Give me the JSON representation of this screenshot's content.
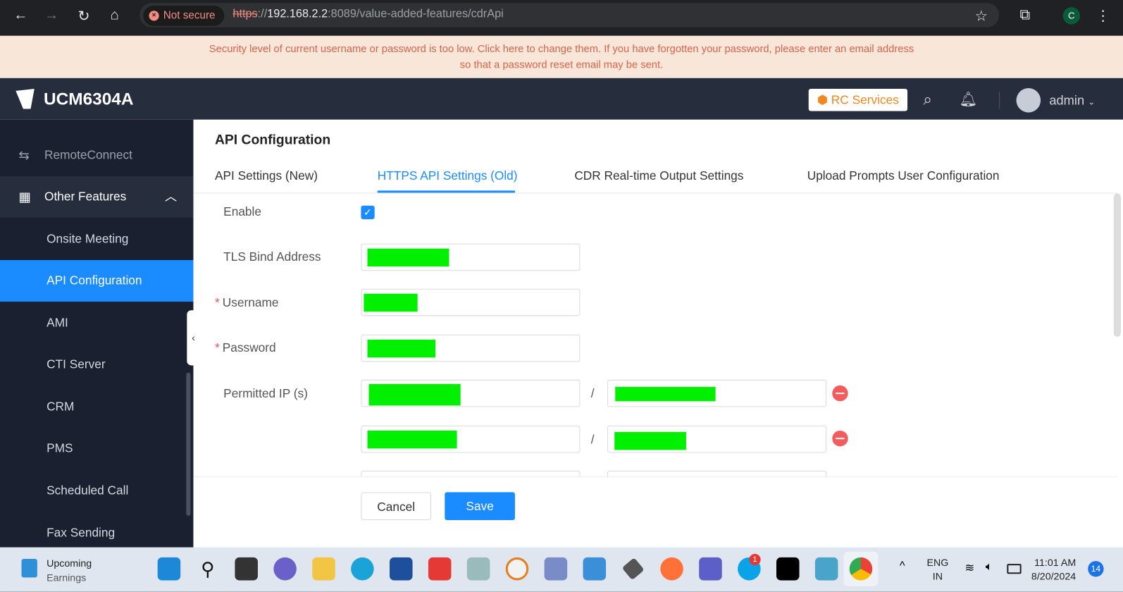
{
  "browser": {
    "security_label": "Not secure",
    "url_scheme": "https",
    "url_sep": "://",
    "url_host": "192.168.2.2",
    "url_rest": ":8089/value-added-features/cdrApi",
    "profile_initial": "C"
  },
  "banner": {
    "text": "Security level of current username or password is too low. Click here to change them. If you have forgotten your password, please enter an email address so that a password reset email may be sent."
  },
  "header": {
    "brand": "UCM6304A",
    "rc_services": "RC Services",
    "user": "admin"
  },
  "sidebar": {
    "items": [
      {
        "label": "RemoteConnect"
      },
      {
        "label": "Other Features"
      },
      {
        "label": "Onsite Meeting"
      },
      {
        "label": "API Configuration",
        "active": true
      },
      {
        "label": "AMI"
      },
      {
        "label": "CTI Server"
      },
      {
        "label": "CRM"
      },
      {
        "label": "PMS"
      },
      {
        "label": "Scheduled Call"
      },
      {
        "label": "Fax Sending"
      }
    ]
  },
  "main": {
    "title": "API Configuration",
    "tabs": [
      {
        "label": "API Settings (New)"
      },
      {
        "label": "HTTPS API Settings (Old)",
        "active": true
      },
      {
        "label": "CDR Real-time Output Settings"
      },
      {
        "label": "Upload Prompts User Configuration"
      }
    ],
    "form": {
      "enable_label": "Enable",
      "enable_checked": true,
      "tls_label": "TLS Bind Address",
      "username_label": "Username",
      "password_label": "Password",
      "permitted_label": "Permitted IP (s)",
      "slash": "/",
      "required_mark": "*"
    },
    "cancel": "Cancel",
    "save": "Save"
  },
  "colors": {
    "accent": "#1a8cff",
    "redaction": "#00f000",
    "sidebar": "#1b2030",
    "topbar": "#262d3d"
  },
  "taskbar": {
    "widget_title": "Upcoming",
    "widget_sub": "Earnings",
    "lang1": "ENG",
    "lang2": "IN",
    "time": "11:01 AM",
    "date": "8/20/2024",
    "notif_count": "14",
    "skype_badge": "1"
  }
}
